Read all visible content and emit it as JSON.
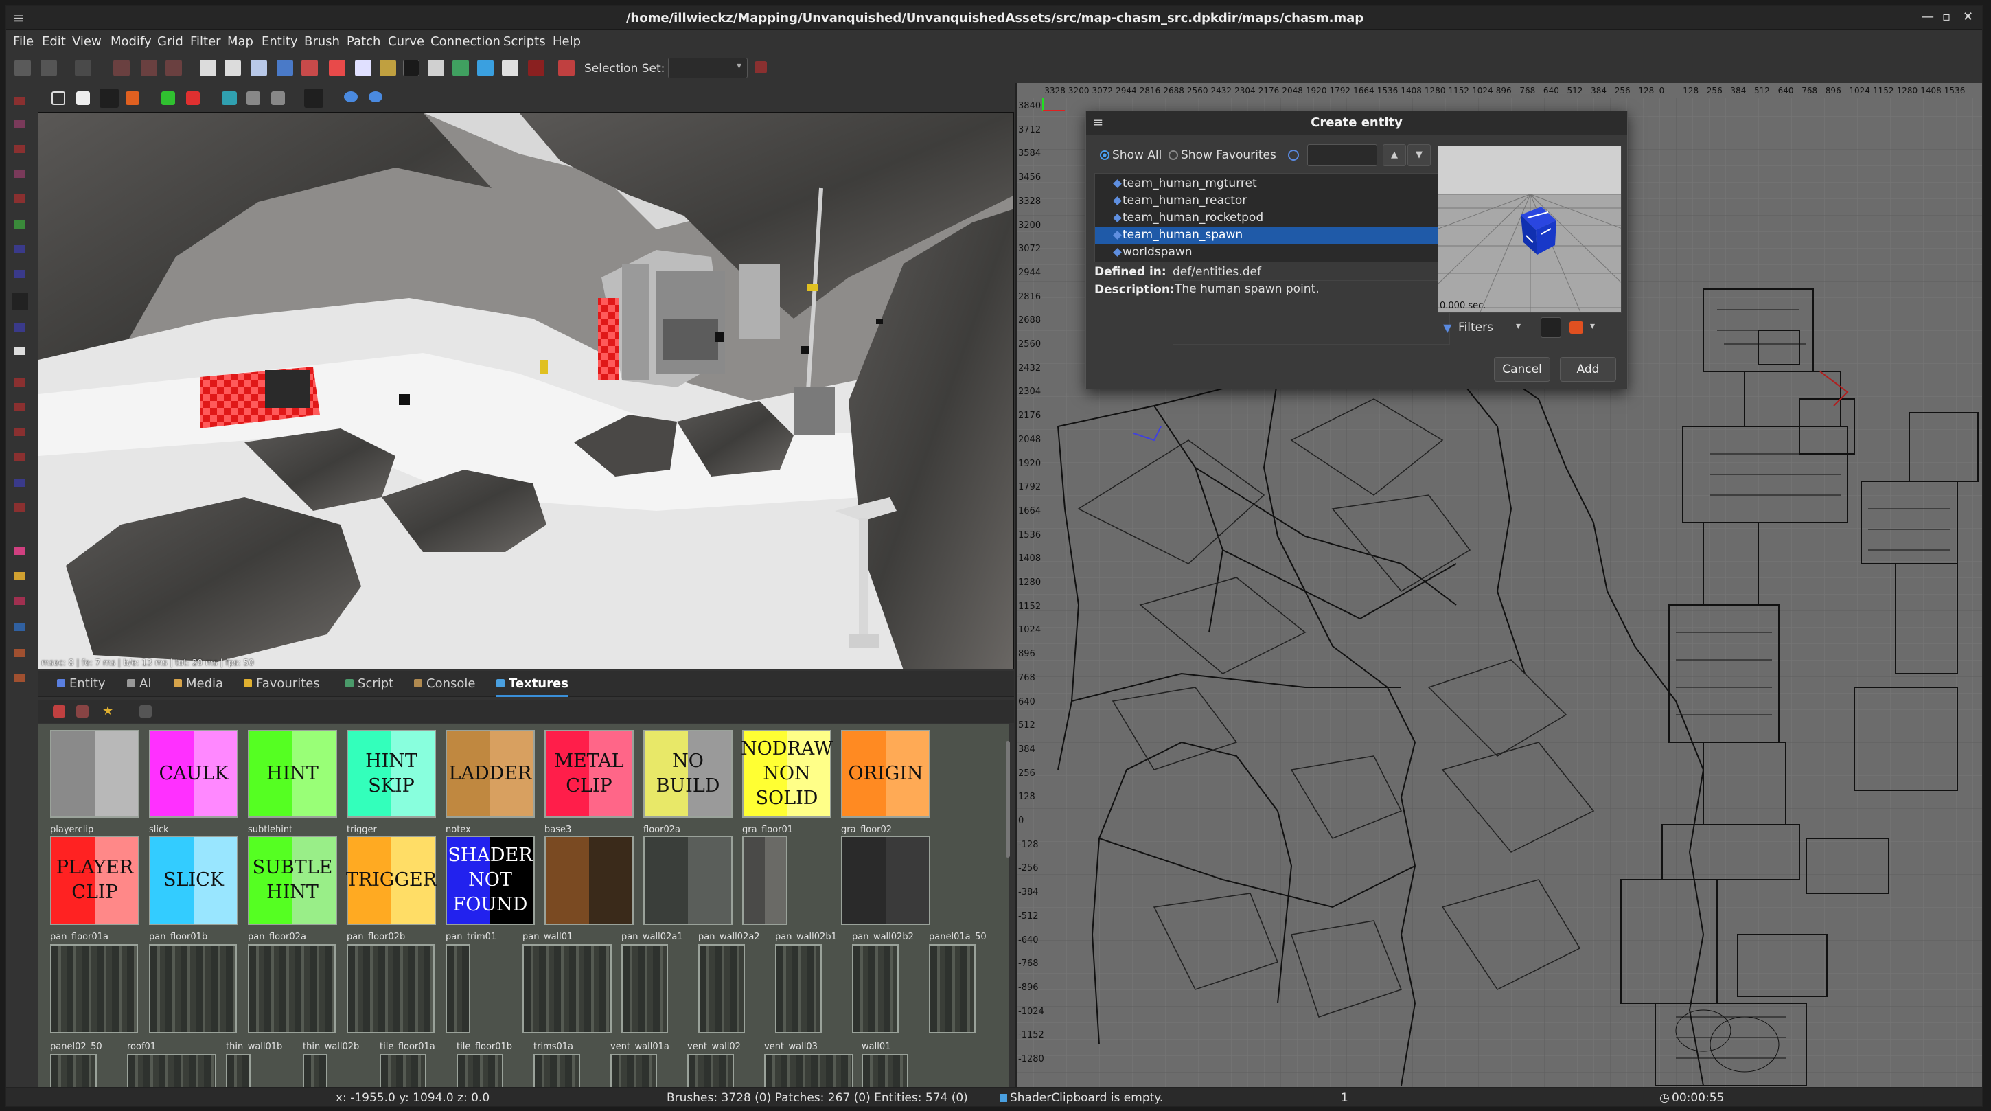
{
  "window": {
    "title": "/home/illwieckz/Mapping/Unvanquished/UnvanquishedAssets/src/map-chasm_src.dpkdir/maps/chasm.map",
    "controls": [
      "—",
      "▫",
      "✕"
    ]
  },
  "menubar": {
    "items": [
      "File",
      "Edit",
      "View",
      "Modify",
      "Grid",
      "Filter",
      "Map",
      "Entity",
      "Brush",
      "Patch",
      "Curve",
      "Connection",
      "Scripts",
      "Help"
    ]
  },
  "toolbar": {
    "selection_set_label": "Selection Set:",
    "selection_set_value": ""
  },
  "camera": {
    "stats": "msec: 8 | fe: 7 ms | b/e: 13 ms | tot: 20 ms | fps: 50"
  },
  "tabs": [
    {
      "label": "Entity",
      "color": "#5a7fe0"
    },
    {
      "label": "AI",
      "color": "#999999"
    },
    {
      "label": "Media",
      "color": "#d6a34a"
    },
    {
      "label": "Favourites",
      "color": "#e0b030"
    },
    {
      "label": "Script",
      "color": "#4a9a6a"
    },
    {
      "label": "Console",
      "color": "#b08a50"
    },
    {
      "label": "Textures",
      "color": "#4aa0e0"
    }
  ],
  "active_tab": "Textures",
  "textures": {
    "row1": [
      {
        "label": "",
        "name": "",
        "colors": [
          "#8a8a8a",
          "#b8b8b8"
        ]
      },
      {
        "label": "CAULK",
        "name": "",
        "colors": [
          "#ff30ff",
          "#ff88ff"
        ]
      },
      {
        "label": "HINT",
        "name": "",
        "colors": [
          "#55ff22",
          "#99ff77"
        ]
      },
      {
        "label": "HINT\nSKIP",
        "name": "",
        "colors": [
          "#33ffbb",
          "#88ffdd"
        ]
      },
      {
        "label": "LADDER",
        "name": "",
        "colors": [
          "#c08840",
          "#d8a060"
        ]
      },
      {
        "label": "METAL\nCLIP",
        "name": "",
        "colors": [
          "#ff1e4a",
          "#ff6688"
        ]
      },
      {
        "label": "NO\nBUILD",
        "name": "",
        "colors": [
          "#e8e868",
          "#9a9a9a"
        ]
      },
      {
        "label": "NODRAW\nNON\nSOLID",
        "name": "",
        "colors": [
          "#ffff33",
          "#ffff88"
        ]
      },
      {
        "label": "ORIGIN",
        "name": "",
        "colors": [
          "#ff8a22",
          "#ffaa55"
        ]
      }
    ],
    "row2": [
      {
        "label": "PLAYER\nCLIP",
        "name": "playerclip",
        "colors": [
          "#ff2222",
          "#ff8888"
        ]
      },
      {
        "label": "SLICK",
        "name": "slick",
        "colors": [
          "#33ccff",
          "#99e6ff"
        ]
      },
      {
        "label": "SUBTLE\nHINT",
        "name": "subtlehint",
        "colors": [
          "#55ff22",
          "#99ee88"
        ]
      },
      {
        "label": "TRIGGER",
        "name": "trigger",
        "colors": [
          "#ffaa22",
          "#ffdd66"
        ]
      },
      {
        "label": "SHADER\nNOT\nFOUND",
        "name": "notex",
        "colors": [
          "#2222ee",
          "#000000"
        ]
      },
      {
        "label": "",
        "name": "base3",
        "colors": [
          "#7a4a22",
          "#3a2a1a"
        ]
      },
      {
        "label": "",
        "name": "floor02a",
        "colors": [
          "#3a3e3a",
          "#5a5e5a"
        ]
      },
      {
        "label": "",
        "name": "gra_floor01",
        "colors": [
          "#4a4a48",
          "#6a6a66"
        ]
      },
      {
        "label": "",
        "name": "gra_floor02",
        "colors": [
          "#2a2a2a",
          "#3a3a3a"
        ]
      }
    ],
    "row3": [
      {
        "name": "pan_floor01a"
      },
      {
        "name": "pan_floor01b"
      },
      {
        "name": "pan_floor02a"
      },
      {
        "name": "pan_floor02b"
      },
      {
        "name": "pan_trim01"
      },
      {
        "name": "pan_wall01"
      },
      {
        "name": "pan_wall02a1"
      },
      {
        "name": "pan_wall02a2"
      },
      {
        "name": "pan_wall02b1"
      },
      {
        "name": "pan_wall02b2"
      },
      {
        "name": "panel01a_50"
      }
    ],
    "row4": [
      {
        "name": "panel02_50"
      },
      {
        "name": "roof01"
      },
      {
        "name": "thin_wall01b"
      },
      {
        "name": "thin_wall02b"
      },
      {
        "name": "tile_floor01a"
      },
      {
        "name": "tile_floor01b"
      },
      {
        "name": "trims01a"
      },
      {
        "name": "vent_wall01a"
      },
      {
        "name": "vent_wall02"
      },
      {
        "name": "vent_wall03"
      },
      {
        "name": "wall01"
      }
    ]
  },
  "xy_ruler_top": [
    "-3328",
    "-3200",
    "-3072",
    "-2944",
    "-2816",
    "-2688",
    "-2560",
    "-2432",
    "-2304",
    "-2176",
    "-2048",
    "-1920",
    "-1792",
    "-1664",
    "-1536",
    "-1408",
    "-1280",
    "-1152",
    "-1024",
    "-896",
    "-768",
    "-640",
    "-512",
    "-384",
    "-256",
    "-128",
    "0",
    "128",
    "256",
    "384",
    "512",
    "640",
    "768",
    "896",
    "1024",
    "1152",
    "1280",
    "1408",
    "1536"
  ],
  "xy_ruler_left": [
    "3840",
    "3712",
    "3584",
    "3456",
    "3328",
    "3200",
    "3072",
    "2944",
    "2816",
    "2688",
    "2560",
    "2432",
    "2304",
    "2176",
    "2048",
    "1920",
    "1792",
    "1664",
    "1536",
    "1408",
    "1280",
    "1152",
    "1024",
    "896",
    "768",
    "640",
    "512",
    "384",
    "256",
    "128",
    "0",
    "-128",
    "-256",
    "-384",
    "-512",
    "-640",
    "-768",
    "-896",
    "-1024",
    "-1152",
    "-1280"
  ],
  "dialog": {
    "title": "Create entity",
    "show_all": "Show All",
    "show_favourites": "Show Favourites",
    "entities": [
      "team_human_mgturret",
      "team_human_reactor",
      "team_human_rocketpod",
      "team_human_spawn",
      "worldspawn"
    ],
    "selected_entity": "team_human_spawn",
    "defined_in_label": "Defined in:",
    "defined_in_value": "def/entities.def",
    "description_label": "Description:",
    "description_value": "The human spawn point.",
    "preview_time": "0.000 sec.",
    "filters_label": "Filters",
    "cancel": "Cancel",
    "add": "Add"
  },
  "status": {
    "coords": "x: -1955.0  y: 1094.0  z:    0.0",
    "counts": "Brushes: 3728 (0) Patches: 267 (0) Entities: 574 (0)",
    "clipboard": "ShaderClipboard is empty.",
    "grid": "1",
    "timer": "00:00:55"
  },
  "colors": {
    "accent": "#3a8fd8",
    "selection": "#1f5aa8",
    "background": "#333333"
  }
}
